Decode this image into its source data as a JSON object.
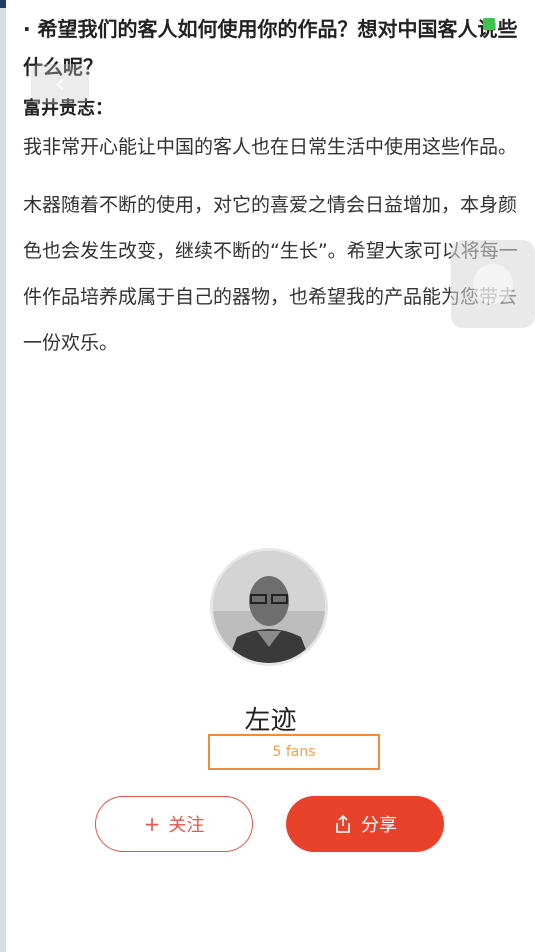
{
  "article": {
    "question": "· 希望我们的客人如何使用你的作品？想对中国客人说些什么呢？",
    "speaker": "富井贵志：",
    "paragraph_1": "我非常开心能让中国的客人也在日常生活中使用这些作品。",
    "paragraph_2": "木器随着不断的使用，对它的喜爱之情会日益增加，本身颜色也会发生改变，继续不断的“生长”。希望大家可以将每一件作品培养成属于自己的器物，也希望我的产品能为您带去一份欢乐。"
  },
  "author": {
    "name": "左迹",
    "fans": "5 fans",
    "follow_label": "关注",
    "follow_prefix": "+",
    "share_label": "分享"
  },
  "colors": {
    "accent": "#e8432a",
    "fans_highlight": "#f08a3c",
    "page_bg": "#ffffff"
  },
  "icons": {
    "back": "chevron-left-icon",
    "share": "share-icon",
    "plus": "plus-icon"
  }
}
